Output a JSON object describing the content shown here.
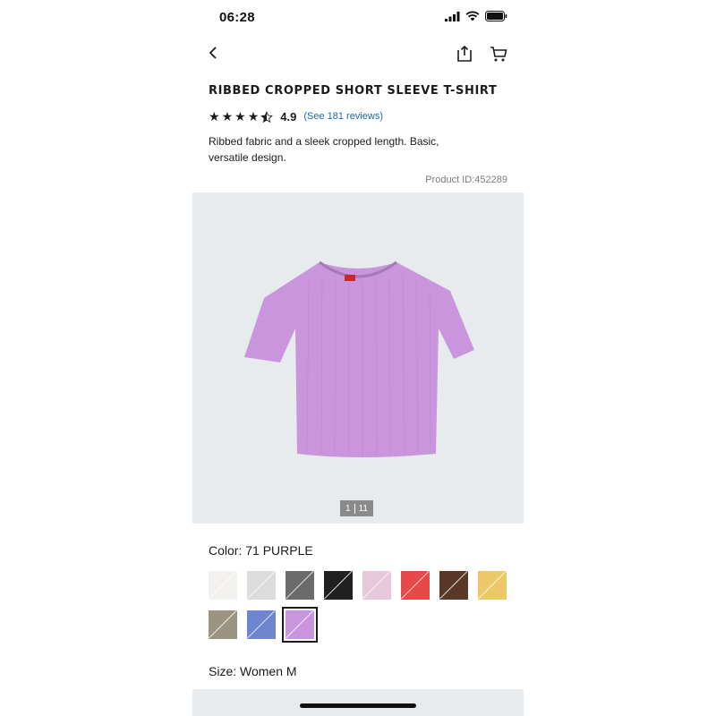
{
  "status_bar": {
    "time": "06:28"
  },
  "product": {
    "title": "RIBBED CROPPED SHORT SLEEVE T-SHIRT",
    "rating": "4.9",
    "rating_stars": 4.5,
    "reviews_link": "(See 181 reviews)",
    "description": "Ribbed fabric and a sleek cropped length. Basic, versatile design.",
    "product_id": "Product ID:452289"
  },
  "gallery": {
    "current": "1",
    "total": "11",
    "shirt_color": "#c996dd"
  },
  "color": {
    "label": "Color: 71 PURPLE",
    "swatches": [
      {
        "name": "off-white",
        "color": "#f2f1ee"
      },
      {
        "name": "light-gray",
        "color": "#dcdcdc"
      },
      {
        "name": "dark-gray",
        "color": "#6b6b6b"
      },
      {
        "name": "black",
        "color": "#202020"
      },
      {
        "name": "pink",
        "color": "#e8c9dc"
      },
      {
        "name": "red",
        "color": "#e64a48"
      },
      {
        "name": "brown",
        "color": "#5a3828"
      },
      {
        "name": "yellow",
        "color": "#ecc866"
      },
      {
        "name": "olive",
        "color": "#9b9480"
      },
      {
        "name": "blue",
        "color": "#6f86cf"
      },
      {
        "name": "purple",
        "color": "#c996dd",
        "selected": true
      }
    ]
  },
  "size": {
    "label": "Size: Women M"
  }
}
